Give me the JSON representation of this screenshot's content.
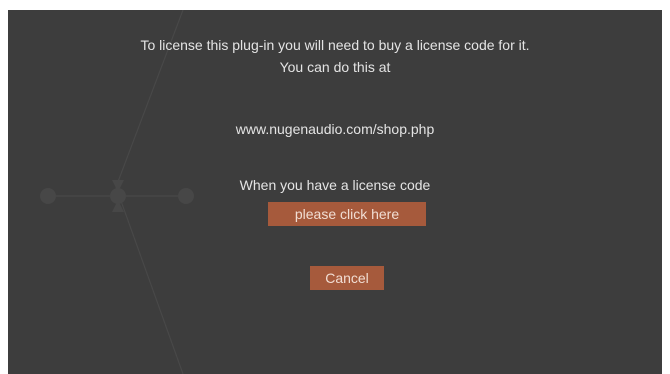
{
  "dialog": {
    "line1": "To license this plug-in you will need to buy a license code for it.",
    "line2": "You can do this at",
    "url": "www.nugenaudio.com/shop.php",
    "license_prompt": "When you have a license code",
    "click_here_label": "please click here",
    "cancel_label": "Cancel"
  },
  "colors": {
    "dialog_background": "#3d3d3d",
    "text": "#e4e4e4",
    "button_background": "#a65a3c",
    "button_text": "#f1ddd3",
    "outer_background": "#ffffff"
  }
}
